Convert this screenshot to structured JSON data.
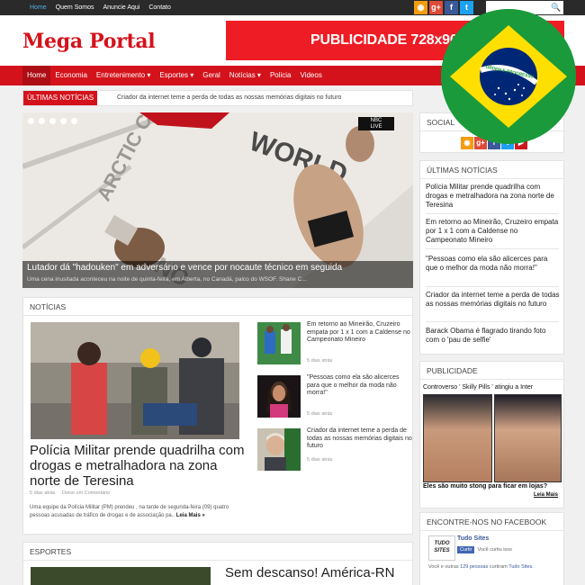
{
  "topbar": {
    "links": [
      "Home",
      "Quem Somos",
      "Anuncie Aqui",
      "Contato"
    ],
    "social_icons": [
      {
        "name": "rss-icon",
        "glyph": "◉",
        "color": "#f39c12"
      },
      {
        "name": "google-plus-icon",
        "glyph": "g+",
        "color": "#dd4b39"
      },
      {
        "name": "facebook-icon",
        "glyph": "f",
        "color": "#3b5998"
      },
      {
        "name": "twitter-icon",
        "glyph": "t",
        "color": "#1da1f2"
      }
    ],
    "search_glyph": "🔍"
  },
  "header": {
    "logo": "Mega Portal",
    "ad_text": "PUBLICIDADE 728x90"
  },
  "nav": {
    "items": [
      "Home",
      "Economia",
      "Entretenimento ▾",
      "Esportes ▾",
      "Geral",
      "Notícias ▾",
      "Policia",
      "Videos"
    ]
  },
  "ticker": {
    "label": "ÚLTIMAS NOTÍCIAS",
    "text": "Criador da internet teme a perda de todas as nossas memórias digitais no futuro"
  },
  "slider": {
    "badge": "NBC\nLIVE",
    "title": "Lutador dá \"hadouken\" em adversário e vence por nocaute técnico em seguida",
    "summary": "Uma cena inusitada aconteceu na noite de quinta-feira, em Alberta, no Canadá, palco do WSOF. Shane C..."
  },
  "noticias": {
    "heading": "NOTÍCIAS",
    "main": {
      "title": "Polícia Militar prende quadrilha com drogas e metralhadora na zona norte de Teresina",
      "date": "5 dias atrás",
      "comments": "Deixe um Comentário",
      "summary": "Uma equipe da Polícia Militar (PM) prendeu , na tarde de segunda-feira (09) quatro pessoas acusadas de tráfico de drogas e de associação pa..",
      "more": "Leia Mais »"
    },
    "side": [
      {
        "title": "Em retorno ao Mineirão, Cruzeiro empata por 1 x 1 com a Caldense no Campeonato Mineiro",
        "date": "5 dias atrás"
      },
      {
        "title": "\"Pessoas como ela são alicerces para que o melhor da moda não morra!\"",
        "date": "5 dias atrás"
      },
      {
        "title": "Criador da internet teme a perda de todas as nossas memórias digitais no futuro",
        "date": "5 dias atrás"
      }
    ]
  },
  "esportes": {
    "heading": "ESPORTES",
    "title": "Sem descanso! América-RN"
  },
  "sidebar": {
    "social_heading": "SOCIAL",
    "social_icons": [
      {
        "name": "rss-icon",
        "glyph": "◉",
        "color": "#f39c12"
      },
      {
        "name": "google-plus-icon",
        "glyph": "g+",
        "color": "#dd4b39"
      },
      {
        "name": "facebook-icon",
        "glyph": "f",
        "color": "#3b5998"
      },
      {
        "name": "twitter-icon",
        "glyph": "t",
        "color": "#1da1f2"
      },
      {
        "name": "youtube-icon",
        "glyph": "▶",
        "color": "#cc181e"
      }
    ],
    "ultimas_heading": "ÚLTIMAS NOTÍCIAS",
    "ultimas": [
      "Polícia Militar prende quadrilha com drogas e metralhadora na zona norte de Teresina",
      "Em retorno ao Mineirão, Cruzeiro empata por 1 x 1 com a Caldense no Campeonato Mineiro",
      "\"Pessoas como ela são alicerces para que o melhor da moda não morra!\"",
      "Criador da internet teme a perda de todas as nossas memórias digitais no futuro",
      "Barack Obama é flagrado tirando foto com o 'pau de selfie'"
    ],
    "pub_heading": "PUBLICIDADE",
    "pub_top": "Controverso ' Skilly Pills ' atingiu a Inter",
    "pub_bottom": "Eles são muito stong para ficar em lojas?",
    "pub_more": "Leia Mais",
    "fb_heading": "ENCONTRE-NOS NO FACEBOOK",
    "fb_logo": "TUDO SITES",
    "fb_name": "Tudo Sites",
    "fb_like": "Curtir",
    "fb_like_text": "Você curtiu isso",
    "fb_count_pre": "Você e outras",
    "fb_count_num": "129 pessoas",
    "fb_count_post": "curtiram",
    "fb_count_page": "Tudo Sites."
  },
  "flag": {
    "motto": "ORDEM E PROGRESSO"
  },
  "colors": {
    "brand_red": "#d4121b",
    "topbar": "#2a2a2a",
    "link_active": "#4fb3e6"
  }
}
